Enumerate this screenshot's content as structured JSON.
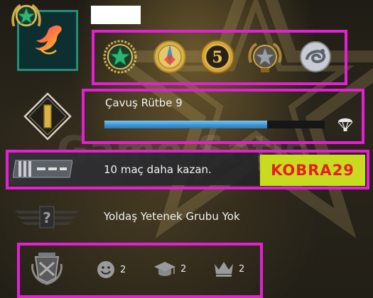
{
  "profile": {
    "avatar_name": "phoenix-avatar",
    "name_redacted": ""
  },
  "medals": [
    {
      "name": "service-star-medal-icon"
    },
    {
      "name": "compass-medal-icon"
    },
    {
      "name": "five-year-coin-icon"
    },
    {
      "name": "veteran-star-medal-icon"
    },
    {
      "name": "serpent-coin-icon"
    }
  ],
  "rank": {
    "title": "Çavuş Rütbe 9",
    "xp_progress": 0.74
  },
  "competitive": {
    "wins_needed_text": "10 maç daha kazan.",
    "tag": "KOBRA29"
  },
  "skill_group": {
    "text": "Yoldaş Yetenek Grubu Yok"
  },
  "commendations": {
    "friendly": "2",
    "teacher": "2",
    "leader": "2"
  },
  "colors": {
    "highlight": "#e61fd6",
    "xp_bar": "#3d97d6",
    "tag_bg": "#c9db20",
    "tag_text": "#e81d24"
  }
}
